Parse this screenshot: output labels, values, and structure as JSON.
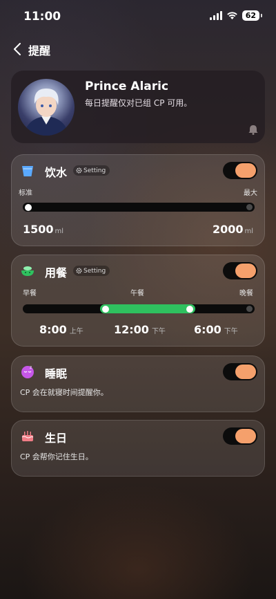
{
  "status_bar": {
    "time": "11:00",
    "battery": "62"
  },
  "nav": {
    "title": "提醒"
  },
  "profile": {
    "name": "Prince Alaric",
    "description": "每日提醒仅对已组 CP 可用。"
  },
  "water": {
    "title": "饮水",
    "setting_label": "Setting",
    "enabled": true,
    "min_label": "标准",
    "max_label": "最大",
    "min_value": "1500",
    "max_value": "2000",
    "unit": "ml"
  },
  "meal": {
    "title": "用餐",
    "setting_label": "Setting",
    "enabled": true,
    "labels": [
      "早餐",
      "午餐",
      "晚餐"
    ],
    "times": [
      {
        "time": "8:00",
        "period": "上午"
      },
      {
        "time": "12:00",
        "period": "下午"
      },
      {
        "time": "6:00",
        "period": "下午"
      }
    ]
  },
  "sleep": {
    "title": "睡眠",
    "description": "CP 会在就寝时间提醒你。",
    "enabled": true
  },
  "birthday": {
    "title": "生日",
    "description": "CP 会帮你记住生日。",
    "enabled": true
  },
  "colors": {
    "accent_toggle": "#f5a06c",
    "meal_green": "#2fc15f",
    "water_blue": "#5aa9ff"
  }
}
